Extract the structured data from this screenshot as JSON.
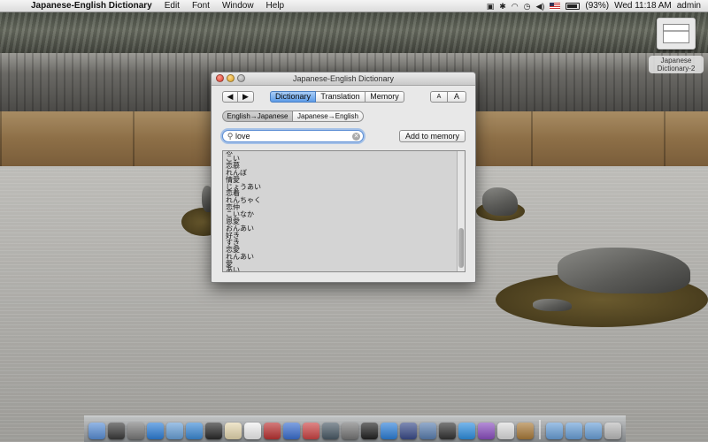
{
  "menubar": {
    "app_name": "Japanese-English Dictionary",
    "items": [
      "Edit",
      "Font",
      "Window",
      "Help"
    ],
    "battery": "(93%)",
    "clock": "Wed 11:18 AM",
    "user": "admin"
  },
  "minimized": {
    "label_line1": "Japanese",
    "label_line2": "Dictionary-2"
  },
  "window": {
    "title": "Japanese-English Dictionary",
    "nav": {
      "back": "◀",
      "forward": "▶"
    },
    "tabs": [
      "Dictionary",
      "Translation",
      "Memory"
    ],
    "active_tab": "Dictionary",
    "font_small": "A",
    "font_large": "A",
    "direction": [
      "English→Japanese",
      "Japanese→English"
    ],
    "active_direction": "English→Japanese",
    "search": {
      "value": "love",
      "placeholder": ""
    },
    "add_button": "Add to memory",
    "results": [
      "恋",
      "こい",
      "恋慕",
      "れんぼ",
      "情愛",
      "じょうあい",
      "恋着",
      "れんちゃく",
      "恋仲",
      "こいなか",
      "恩愛",
      "おんあい",
      "好き",
      "すき",
      "恋愛",
      "れんあい",
      "愛",
      "あい"
    ]
  },
  "dock": {
    "icons": [
      "finder-icon",
      "dashboard-icon",
      "system-prefs-icon",
      "safari-icon",
      "preview-icon",
      "ichat-icon",
      "quicktime-icon",
      "textedit-icon",
      "ical-icon",
      "photobooth-icon",
      "itunes-icon",
      "photo-icon",
      "timemachine-icon",
      "utility-icon",
      "terminal-icon",
      "safari-2-icon",
      "xcode-icon",
      "network-icon",
      "activity-icon",
      "app-store-icon",
      "itunes-2-icon",
      "script-icon",
      "dictionary-icon",
      "folder-icon",
      "folder-2-icon",
      "downloads-icon",
      "trash-icon"
    ]
  }
}
